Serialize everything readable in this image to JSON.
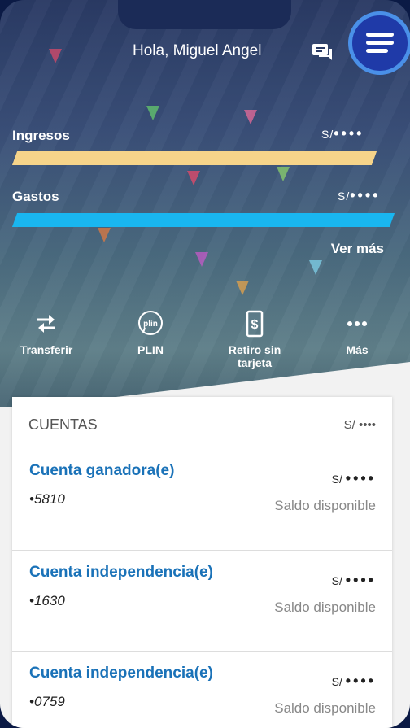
{
  "header": {
    "greeting": "Hola, Miguel Angel"
  },
  "summary": {
    "ingresos": {
      "label": "Ingresos",
      "amount": "S/",
      "mask": "••••",
      "color": "#f6d48a"
    },
    "gastos": {
      "label": "Gastos",
      "amount": "S/",
      "mask": "••••",
      "color": "#19b6f0"
    },
    "ver_mas": "Ver más"
  },
  "actions": [
    {
      "label": "Transferir",
      "icon": "transfer-icon"
    },
    {
      "label": "PLIN",
      "icon": "plin-icon"
    },
    {
      "label": "Retiro sin tarjeta",
      "icon": "cash-withdrawal-icon"
    },
    {
      "label": "Más",
      "icon": "more-icon"
    }
  ],
  "accounts": {
    "title": "CUENTAS",
    "total": "S/ ••••",
    "items": [
      {
        "name": "Cuenta ganadora(e)",
        "number": "•5810",
        "currency": "S/",
        "mask": "••••",
        "note": "Saldo disponible"
      },
      {
        "name": "Cuenta independencia(e)",
        "number": "•1630",
        "currency": "S/",
        "mask": "••••",
        "note": "Saldo disponible"
      },
      {
        "name": "Cuenta independencia(e)",
        "number": "•0759",
        "currency": "S/",
        "mask": "••••",
        "note": "Saldo disponible"
      }
    ]
  },
  "colors": {
    "accent": "#1a72b8",
    "menu": "#1f3aa8",
    "menu_ring": "#4a90e8"
  }
}
